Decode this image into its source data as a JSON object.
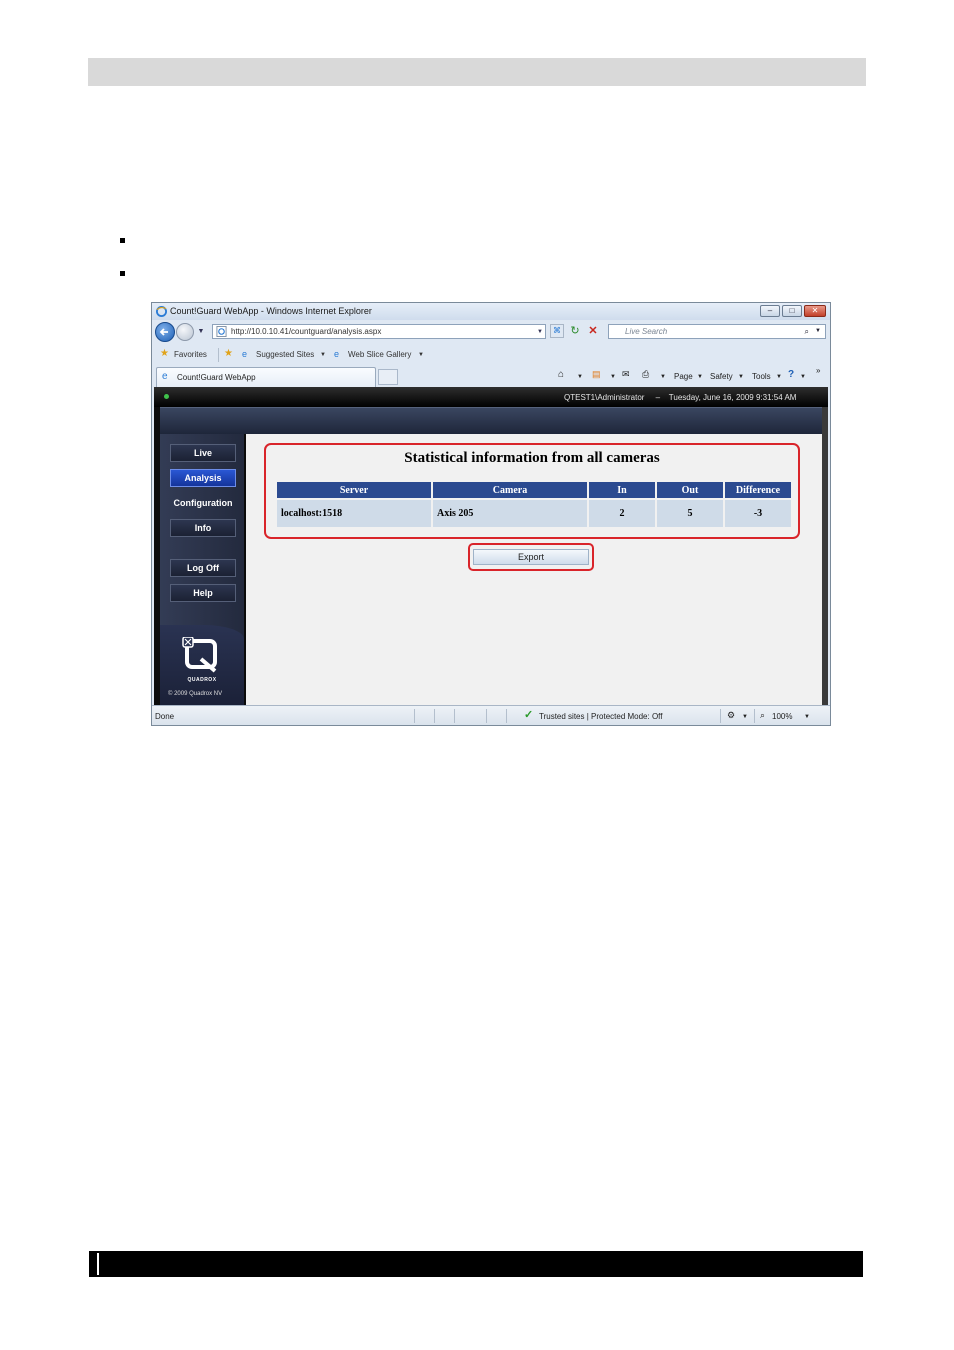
{
  "browser": {
    "window_title": "Count!Guard WebApp - Windows Internet Explorer",
    "url": "http://10.0.10.41/countguard/analysis.aspx",
    "search_placeholder": "Live Search",
    "favorites": [
      "Favorites",
      "Suggested Sites",
      "Web Slice Gallery"
    ],
    "tab_title": "Count!Guard WebApp",
    "commands": [
      "Page",
      "Safety",
      "Tools"
    ],
    "status": {
      "left": "Done",
      "zone": "Trusted sites | Protected Mode: Off",
      "zoom": "100%"
    }
  },
  "app": {
    "header_user": "QTEST1\\Administrator",
    "header_sep": "–",
    "header_datetime": "Tuesday, June 16, 2009 9:31:54 AM",
    "menu": [
      "Live",
      "Analysis",
      "Configuration",
      "Info"
    ],
    "menu2": [
      "Log Off",
      "Help"
    ],
    "logo_text": "QUADROX",
    "copyright": "© 2009 Quadrox NV",
    "stats": {
      "title": "Statistical information from all cameras",
      "columns": [
        "Server",
        "Camera",
        "In",
        "Out",
        "Difference"
      ],
      "rows": [
        [
          "localhost:1518",
          "Axis 205",
          "2",
          "5",
          "-3"
        ]
      ]
    },
    "export_label": "Export"
  },
  "colors": {
    "highlight_red": "#d9242a",
    "table_header": "#2b4a90",
    "table_cell": "#cfdbe8",
    "active_menu": "#1f45bf"
  }
}
